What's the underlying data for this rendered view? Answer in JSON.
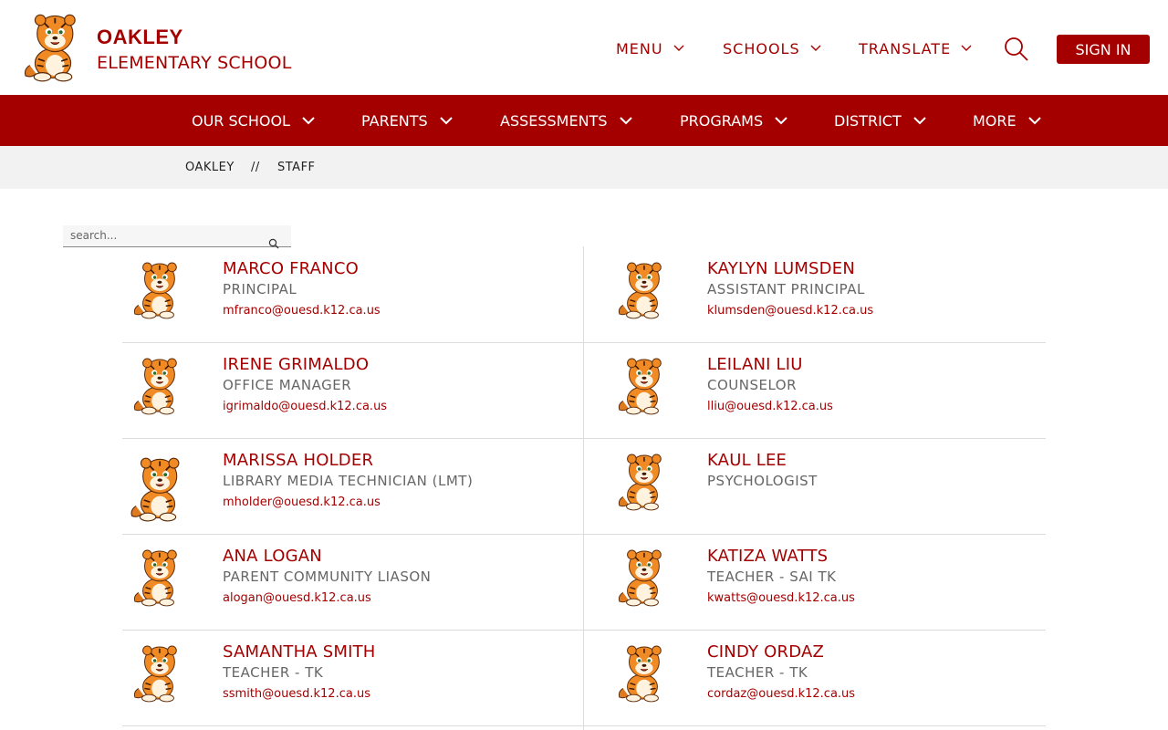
{
  "school": {
    "name_line1": "OAKLEY",
    "name_line2": "ELEMENTARY SCHOOL"
  },
  "top_nav": {
    "menu": "MENU",
    "schools": "SCHOOLS",
    "translate": "TRANSLATE",
    "sign_in": "SIGN IN"
  },
  "main_nav": [
    {
      "label": "OUR SCHOOL"
    },
    {
      "label": "PARENTS"
    },
    {
      "label": "ASSESSMENTS"
    },
    {
      "label": "PROGRAMS"
    },
    {
      "label": "DISTRICT"
    },
    {
      "label": "MORE"
    }
  ],
  "breadcrumb": {
    "home": "OAKLEY",
    "separator": "//",
    "current": "STAFF"
  },
  "search": {
    "placeholder": "search..."
  },
  "staff": [
    {
      "name": "MARCO FRANCO",
      "title": "PRINCIPAL",
      "email": "mfranco@ouesd.k12.ca.us"
    },
    {
      "name": "KAYLYN LUMSDEN",
      "title": "ASSISTANT PRINCIPAL",
      "email": "klumsden@ouesd.k12.ca.us"
    },
    {
      "name": "IRENE GRIMALDO",
      "title": "OFFICE MANAGER",
      "email": "igrimaldo@ouesd.k12.ca.us"
    },
    {
      "name": "LEILANI LIU",
      "title": "COUNSELOR",
      "email": "lliu@ouesd.k12.ca.us"
    },
    {
      "name": "MARISSA HOLDER",
      "title": "LIBRARY MEDIA TECHNICIAN (LMT)",
      "email": "mholder@ouesd.k12.ca.us"
    },
    {
      "name": "KAUL LEE",
      "title": "PSYCHOLOGIST",
      "email": ""
    },
    {
      "name": "ANA LOGAN",
      "title": "PARENT COMMUNITY LIASON",
      "email": "alogan@ouesd.k12.ca.us"
    },
    {
      "name": "KATIZA WATTS",
      "title": "TEACHER - SAI TK",
      "email": "kwatts@ouesd.k12.ca.us"
    },
    {
      "name": "SAMANTHA SMITH",
      "title": "TEACHER - TK",
      "email": "ssmith@ouesd.k12.ca.us"
    },
    {
      "name": "CINDY ORDAZ",
      "title": "TEACHER - TK",
      "email": "cordaz@ouesd.k12.ca.us"
    }
  ],
  "colors": {
    "brand": "#a50000",
    "breadcrumb_bg": "#f2f2f2",
    "muted_text": "#666666"
  }
}
